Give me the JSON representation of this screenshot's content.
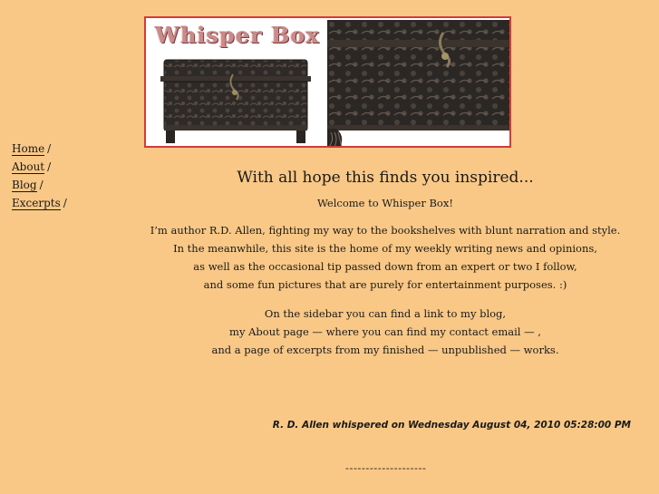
{
  "banner": {
    "title": "Whisper Box"
  },
  "sidebar": {
    "items": [
      {
        "label": "Home",
        "sep": "/"
      },
      {
        "label": "About",
        "sep": "/"
      },
      {
        "label": "Blog",
        "sep": "/"
      },
      {
        "label": "Excerpts",
        "sep": "/"
      }
    ]
  },
  "main": {
    "headline": "With all hope this finds you inspired...",
    "welcome": "Welcome to Whisper Box!",
    "intro_lines": [
      "I’m author R.D. Allen, fighting my way to the bookshelves with blunt narration and style.",
      "In the meanwhile, this site is the home of my weekly writing news and opinions,",
      "as well as the occasional tip passed down from an expert or two I follow,",
      "and some fun pictures that are purely for entertainment purposes. :)"
    ],
    "sidebar_lines": [
      "On the sidebar you can find a link to my blog,",
      "my About page — where you can find my contact email — ,",
      "and a page of excerpts from my finished — unpublished — works."
    ]
  },
  "post": {
    "byline": "R. D. Allen whispered on Wednesday August 04, 2010 05:28:00 PM",
    "divider": "--------------------"
  },
  "colors": {
    "background": "#f9c886",
    "banner_border": "#d43a3a",
    "title_pink": "#c98a8a"
  }
}
